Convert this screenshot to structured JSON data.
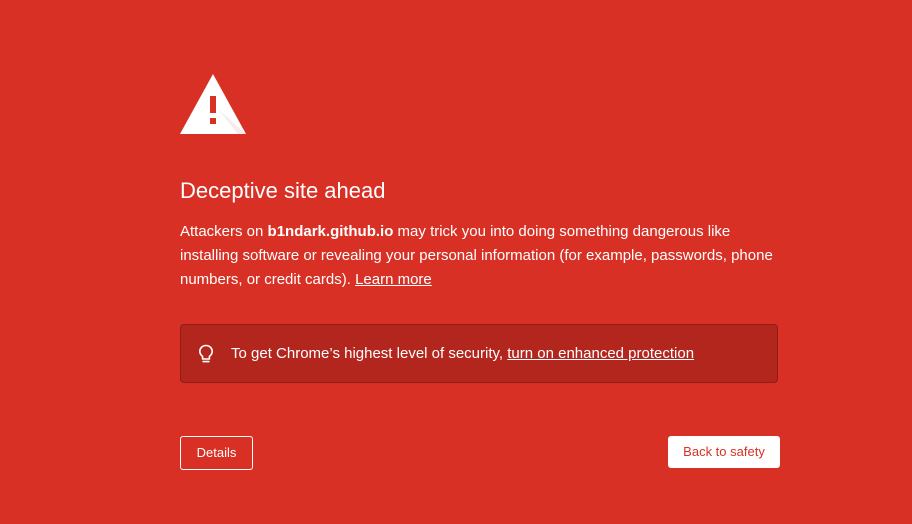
{
  "colors": {
    "background": "#d93025",
    "promo_background": "#b3261e",
    "text": "#ffffff",
    "accent_button_text": "#d93025"
  },
  "icons": {
    "warning": "warning-triangle-icon",
    "promo": "lightbulb-icon"
  },
  "interstitial": {
    "title": "Deceptive site ahead",
    "body_prefix": "Attackers on ",
    "domain": "b1ndark.github.io",
    "body_suffix": " may trick you into doing something dangerous like installing software or revealing your personal information (for example, passwords, phone numbers, or credit cards). ",
    "learn_more": "Learn more"
  },
  "promo": {
    "text": "To get Chrome’s highest level of security, ",
    "link": "turn on enhanced protection"
  },
  "buttons": {
    "details": "Details",
    "back_to_safety": "Back to safety"
  }
}
